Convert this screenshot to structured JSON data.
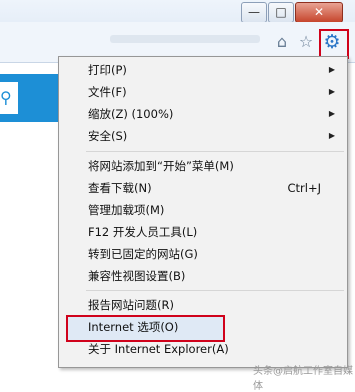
{
  "window": {
    "min_label": "—",
    "max_label": "□",
    "close_label": "✕"
  },
  "toolbar": {
    "home_glyph": "⌂",
    "star_glyph": "☆",
    "gear_glyph": "⚙",
    "search_glyph": "⚲"
  },
  "menu": {
    "items": [
      {
        "label": "打印(P)",
        "arrow": "▶"
      },
      {
        "label": "文件(F)",
        "arrow": "▶"
      },
      {
        "label": "缩放(Z) (100%)",
        "arrow": "▶"
      },
      {
        "label": "安全(S)",
        "arrow": "▶"
      },
      {
        "label": "将网站添加到“开始”菜单(M)"
      },
      {
        "label": "查看下载(N)",
        "shortcut": "Ctrl+J"
      },
      {
        "label": "管理加载项(M)"
      },
      {
        "label": "F12 开发人员工具(L)"
      },
      {
        "label": "转到已固定的网站(G)"
      },
      {
        "label": "兼容性视图设置(B)"
      },
      {
        "label": "报告网站问题(R)"
      },
      {
        "label": "Internet 选项(O)"
      },
      {
        "label": "关于 Internet Explorer(A)"
      }
    ]
  },
  "watermark": "头条@启航工作室自媒体"
}
